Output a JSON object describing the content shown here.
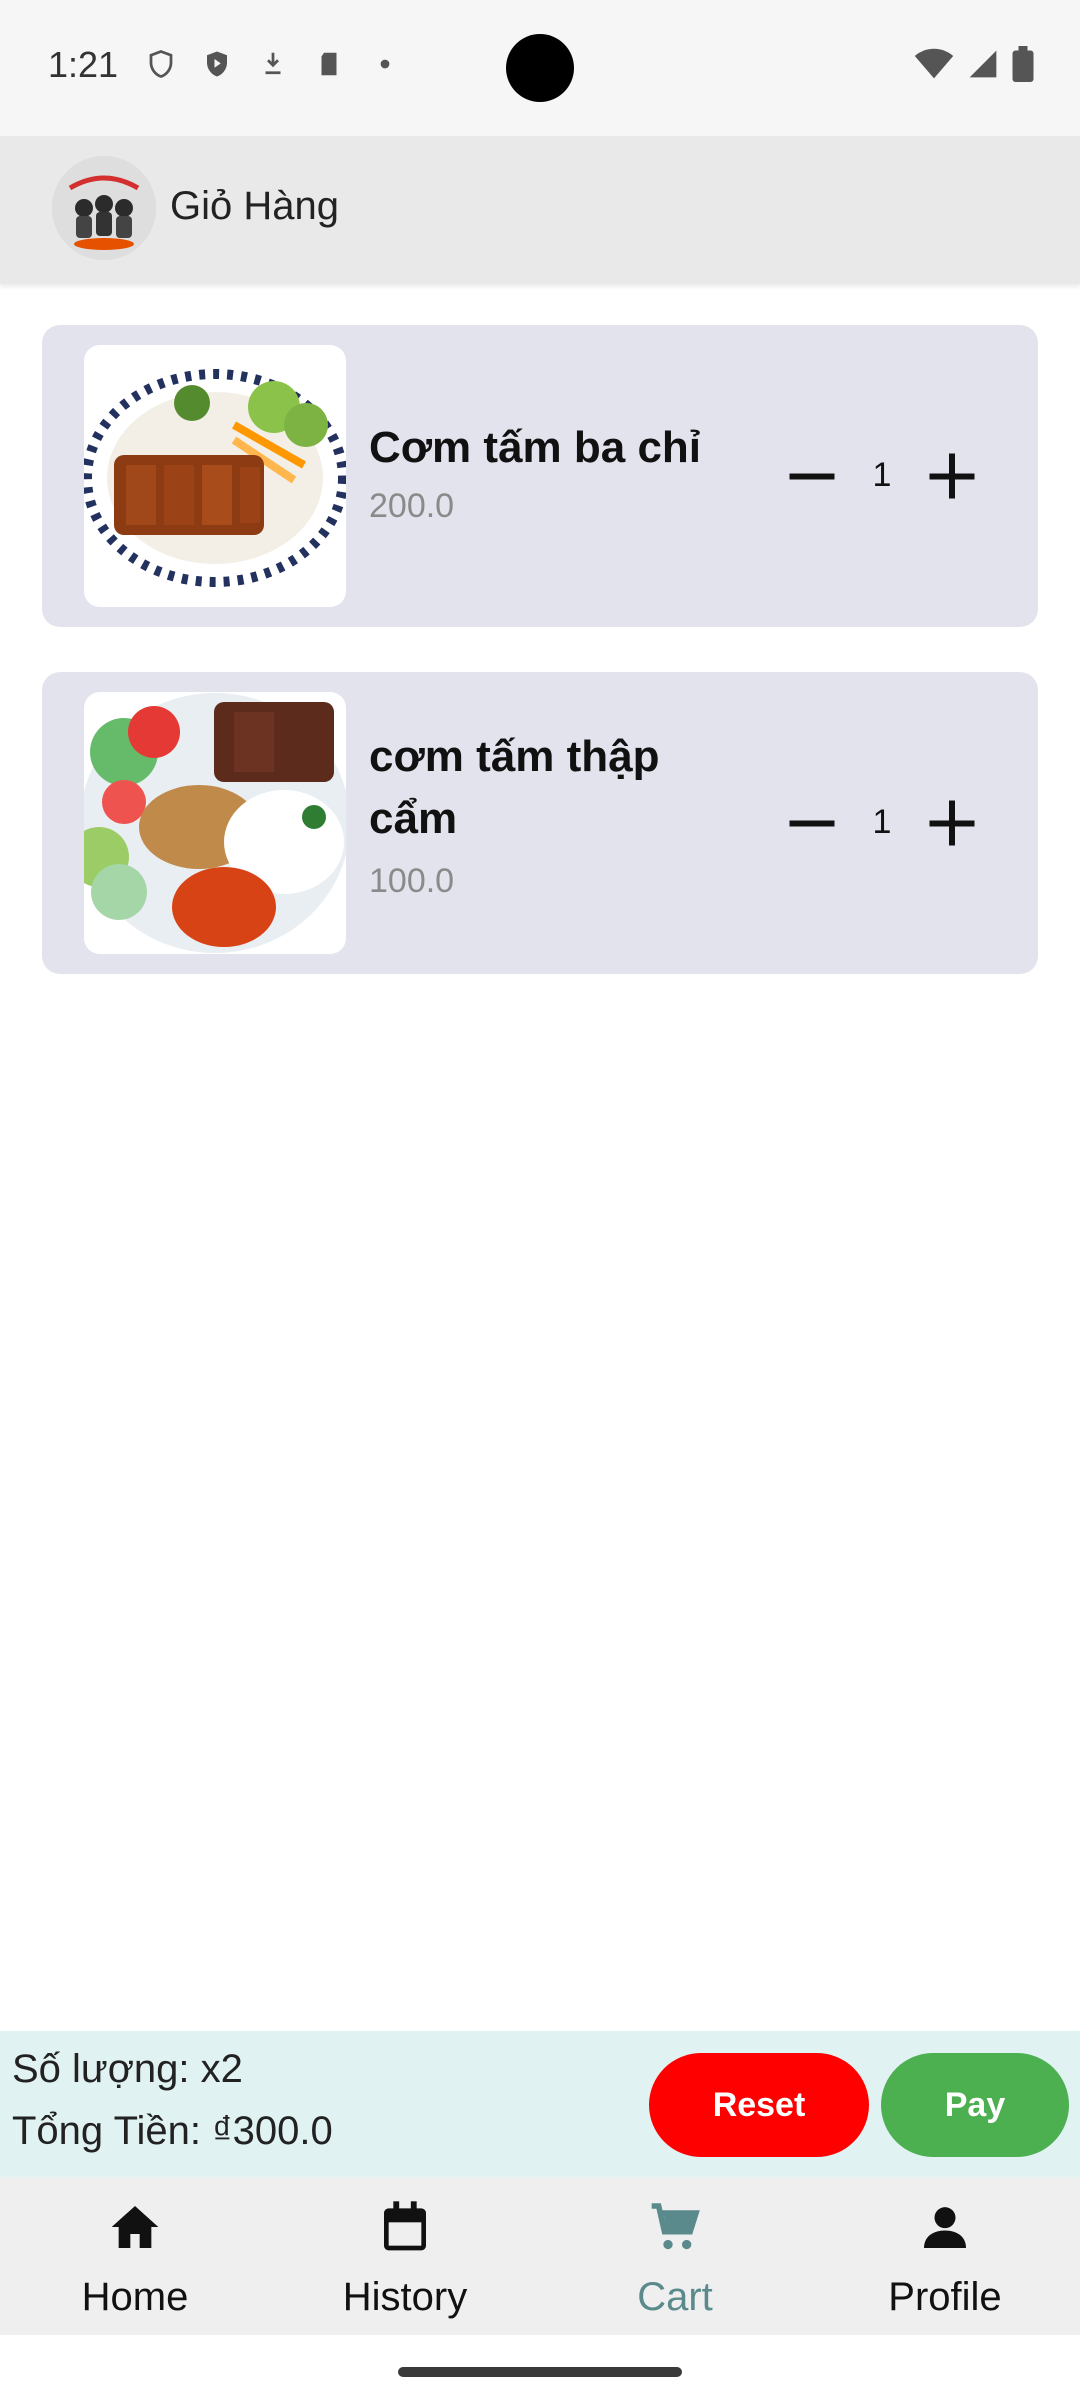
{
  "status_bar": {
    "time": "1:21"
  },
  "app_bar": {
    "title": "Giỏ Hàng",
    "logo_icon": "restaurant-logo"
  },
  "cart": {
    "items": [
      {
        "name": "Cơm tấm ba chỉ",
        "price": "200.0",
        "quantity": "1",
        "image_icon": "grilled-pork-rice-image"
      },
      {
        "name": "cơm tấm thập cẩm",
        "price": "100.0",
        "quantity": "1",
        "image_icon": "mixed-rice-platter-image"
      }
    ]
  },
  "summary": {
    "quantity_text": "Số lượng: x2",
    "total_text": "Tổng Tiền: ₫300.0",
    "reset_label": "Reset",
    "pay_label": "Pay"
  },
  "bottom_nav": {
    "items": [
      {
        "label": "Home",
        "icon": "home-icon",
        "active": false
      },
      {
        "label": "History",
        "icon": "calendar-icon",
        "active": false
      },
      {
        "label": "Cart",
        "icon": "cart-icon",
        "active": true
      },
      {
        "label": "Profile",
        "icon": "person-icon",
        "active": false
      }
    ]
  },
  "colors": {
    "reset": "#ff0000",
    "pay": "#4caf50",
    "active_nav": "#5a8a8c",
    "summary_bg": "#e0f2f1",
    "card_bg": "#e3e3ee"
  }
}
